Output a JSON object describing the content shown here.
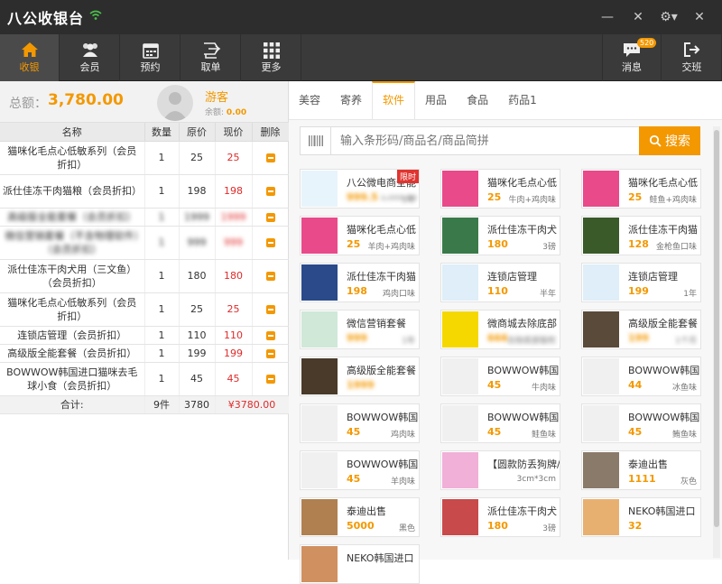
{
  "titlebar": {
    "app_title": "八公收银台",
    "minimize": "—",
    "restore": "✕",
    "settings": "⚙▾",
    "close": "✕"
  },
  "toolbar": {
    "items": [
      {
        "label": "收银",
        "icon": "home-icon"
      },
      {
        "label": "会员",
        "icon": "members-icon"
      },
      {
        "label": "预约",
        "icon": "calendar-icon"
      },
      {
        "label": "取单",
        "icon": "retrieve-order-icon"
      },
      {
        "label": "更多",
        "icon": "grid-icon"
      }
    ],
    "messages_label": "消息",
    "messages_badge": "520",
    "handover_label": "交班"
  },
  "summary": {
    "total_label": "总额：",
    "total_value": "3,780.00",
    "member_name": "游客",
    "balance_label": "余额:",
    "balance_value": "0.00"
  },
  "cart": {
    "headers": [
      "名称",
      "数量",
      "原价",
      "现价",
      "删除"
    ],
    "rows": [
      {
        "name": "猫咪化毛点心低敏系列（会员折扣）",
        "qty": "1",
        "orig": "25",
        "now": "25",
        "blur": false
      },
      {
        "name": "派仕佳冻干肉猫粮（会员折扣）",
        "qty": "1",
        "orig": "198",
        "now": "198",
        "blur": false
      },
      {
        "name": "高级版全能套餐（会员折扣）",
        "qty": "1",
        "orig": "1999",
        "now": "1999",
        "blur": true
      },
      {
        "name": "微信营销套餐（不含物理软件）（会员折扣）",
        "qty": "1",
        "orig": "999",
        "now": "999",
        "blur": true
      },
      {
        "name": "派仕佳冻干肉犬用（三文鱼）（会员折扣）",
        "qty": "1",
        "orig": "180",
        "now": "180",
        "blur": false
      },
      {
        "name": "猫咪化毛点心低敏系列（会员折扣）",
        "qty": "1",
        "orig": "25",
        "now": "25",
        "blur": false
      },
      {
        "name": "连锁店管理（会员折扣）",
        "qty": "1",
        "orig": "110",
        "now": "110",
        "blur": false
      },
      {
        "name": "高级版全能套餐（会员折扣）",
        "qty": "1",
        "orig": "199",
        "now": "199",
        "blur": false
      },
      {
        "name": "BOWWOW韩国进口猫咪去毛球小食（会员折扣）",
        "qty": "1",
        "orig": "45",
        "now": "45",
        "blur": false
      }
    ],
    "total": {
      "label": "合计:",
      "qty": "9件",
      "orig": "3780",
      "now": "¥3780.00"
    }
  },
  "tabs": [
    "美容",
    "寄养",
    "软件",
    "用品",
    "食品",
    "药品1"
  ],
  "active_tab": 2,
  "search": {
    "placeholder": "输入条形码/商品名/商品简拼",
    "button_label": "搜索"
  },
  "products": [
    {
      "name": "八公微电商全能",
      "price": "999.5",
      "orig": "1,999.00",
      "spec": "1年",
      "tag": "限时",
      "thumb": "#e8f4fb",
      "blur": true
    },
    {
      "name": "猫咪化毛点心低",
      "price": "25",
      "spec": "牛肉+鸡肉味",
      "thumb": "#e84a8a"
    },
    {
      "name": "猫咪化毛点心低",
      "price": "25",
      "spec": "鲑鱼+鸡肉味",
      "thumb": "#e84a8a"
    },
    {
      "name": "猫咪化毛点心低",
      "price": "25",
      "spec": "羊肉+鸡肉味",
      "thumb": "#e84a8a"
    },
    {
      "name": "派仕佳冻干肉犬",
      "price": "180",
      "spec": "3磅",
      "thumb": "#3a7a4a"
    },
    {
      "name": "派仕佳冻干肉猫",
      "price": "128",
      "spec": "金枪鱼口味",
      "thumb": "#3a5a2a"
    },
    {
      "name": "派仕佳冻干肉猫",
      "price": "198",
      "spec": "鸡肉口味",
      "thumb": "#2a4a8a"
    },
    {
      "name": "连锁店管理",
      "price": "110",
      "spec": "半年",
      "thumb": "#dfeef8"
    },
    {
      "name": "连锁店管理",
      "price": "199",
      "spec": "1年",
      "thumb": "#dfeef8"
    },
    {
      "name": "微信营销套餐",
      "price": "999",
      "spec": "1年",
      "thumb": "#cfe8d8",
      "blur": true
    },
    {
      "name": "微商城去除底部",
      "price": "666",
      "spec": "去除底部版权",
      "thumb": "#f5d800",
      "blur": true
    },
    {
      "name": "高级版全能套餐",
      "price": "199",
      "spec": "1个月",
      "thumb": "#5a4a3a",
      "blur": true
    },
    {
      "name": "高级版全能套餐",
      "price": "1999",
      "spec": "",
      "thumb": "#4a3a2a",
      "blur": true
    },
    {
      "name": "BOWWOW韩国",
      "price": "45",
      "spec": "牛肉味",
      "thumb": "#f0f0f0"
    },
    {
      "name": "BOWWOW韩国",
      "price": "44",
      "spec": "冰鱼味",
      "thumb": "#f0f0f0"
    },
    {
      "name": "BOWWOW韩国",
      "price": "45",
      "spec": "鸡肉味",
      "thumb": "#f0f0f0"
    },
    {
      "name": "BOWWOW韩国",
      "price": "45",
      "spec": "鲑鱼味",
      "thumb": "#f0f0f0"
    },
    {
      "name": "BOWWOW韩国",
      "price": "45",
      "spec": "鲔鱼味",
      "thumb": "#f0f0f0"
    },
    {
      "name": "BOWWOW韩国",
      "price": "45",
      "spec": "羊肉味",
      "thumb": "#f0f0f0"
    },
    {
      "name": "【圆款防丢狗牌/",
      "price": "",
      "spec": "3cm*3cm",
      "thumb": "#f0b0d8"
    },
    {
      "name": "泰迪出售",
      "price": "1111",
      "spec": "灰色",
      "thumb": "#8a7a6a"
    },
    {
      "name": "泰迪出售",
      "price": "5000",
      "spec": "黑色",
      "thumb": "#b08050"
    },
    {
      "name": "派仕佳冻干肉犬",
      "price": "180",
      "spec": "3磅",
      "thumb": "#c84a4a"
    },
    {
      "name": "NEKO韩国进口",
      "price": "32",
      "spec": "",
      "thumb": "#e8b070"
    },
    {
      "name": "NEKO韩国进口",
      "price": "",
      "spec": "",
      "thumb": "#d09060"
    }
  ],
  "colors": {
    "accent": "#f39800",
    "titlebar": "#2d2d2d",
    "toolbar": "#3a3a3a",
    "price_red": "#e02a2a"
  }
}
